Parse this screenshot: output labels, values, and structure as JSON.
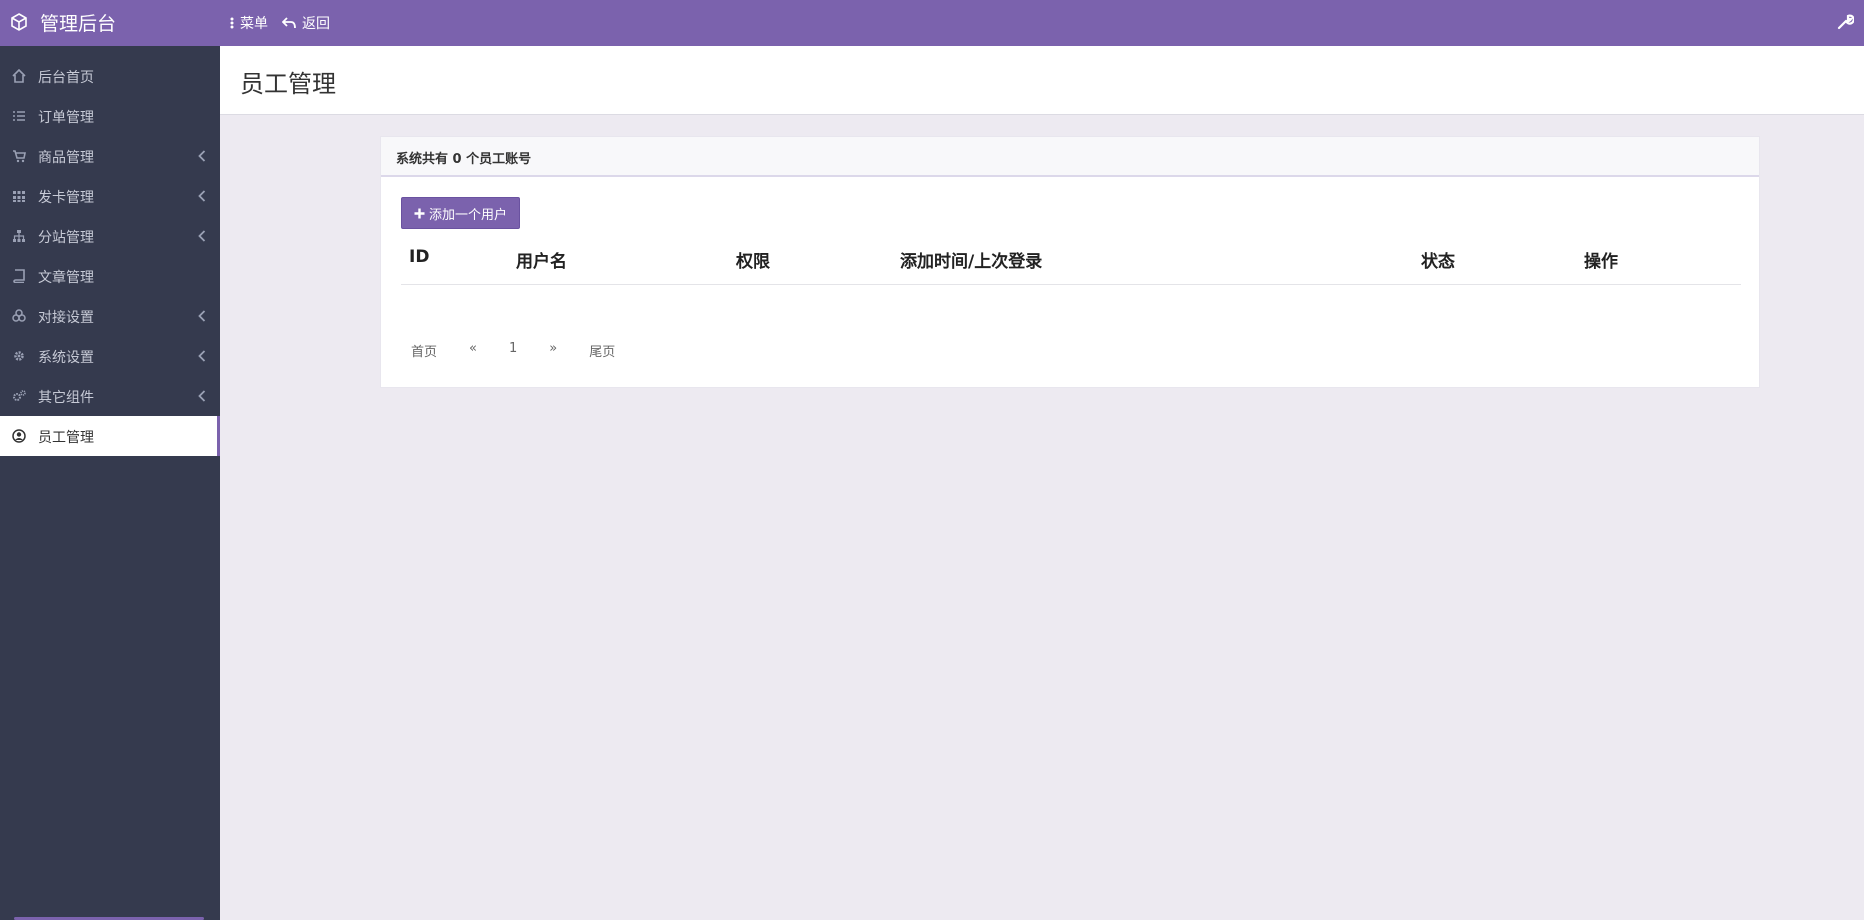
{
  "topbar": {
    "brand": "管理后台",
    "nav": [
      {
        "icon": "ellipsis-vertical-icon",
        "label": "菜单"
      },
      {
        "icon": "reply-icon",
        "label": "返回"
      }
    ],
    "right_icon": "wrench-icon"
  },
  "sidebar": {
    "items": [
      {
        "label": "后台首页",
        "icon": "home-icon",
        "has_children": false,
        "active": false
      },
      {
        "label": "订单管理",
        "icon": "list-icon",
        "has_children": false,
        "active": false
      },
      {
        "label": "商品管理",
        "icon": "cart-icon",
        "has_children": true,
        "active": false
      },
      {
        "label": "发卡管理",
        "icon": "grid-icon",
        "has_children": true,
        "active": false
      },
      {
        "label": "分站管理",
        "icon": "sitemap-icon",
        "has_children": true,
        "active": false
      },
      {
        "label": "文章管理",
        "icon": "book-icon",
        "has_children": false,
        "active": false
      },
      {
        "label": "对接设置",
        "icon": "cubes-icon",
        "has_children": true,
        "active": false
      },
      {
        "label": "系统设置",
        "icon": "gear-icon",
        "has_children": true,
        "active": false
      },
      {
        "label": "其它组件",
        "icon": "gears-icon",
        "has_children": true,
        "active": false
      },
      {
        "label": "员工管理",
        "icon": "user-circle-icon",
        "has_children": false,
        "active": true
      }
    ]
  },
  "page": {
    "title": "员工管理"
  },
  "panel": {
    "heading": "系统共有 0 个员工账号",
    "add_button": "添加一个用户",
    "columns": [
      "ID",
      "用户名",
      "权限",
      "添加时间/上次登录",
      "状态",
      "操作"
    ],
    "rows": [],
    "pager": [
      "首页",
      "«",
      "1",
      "»",
      "尾页"
    ]
  },
  "colors": {
    "accent": "#7b62ad",
    "sidebar_bg": "#353a4e",
    "page_bg": "#edeaf1"
  }
}
